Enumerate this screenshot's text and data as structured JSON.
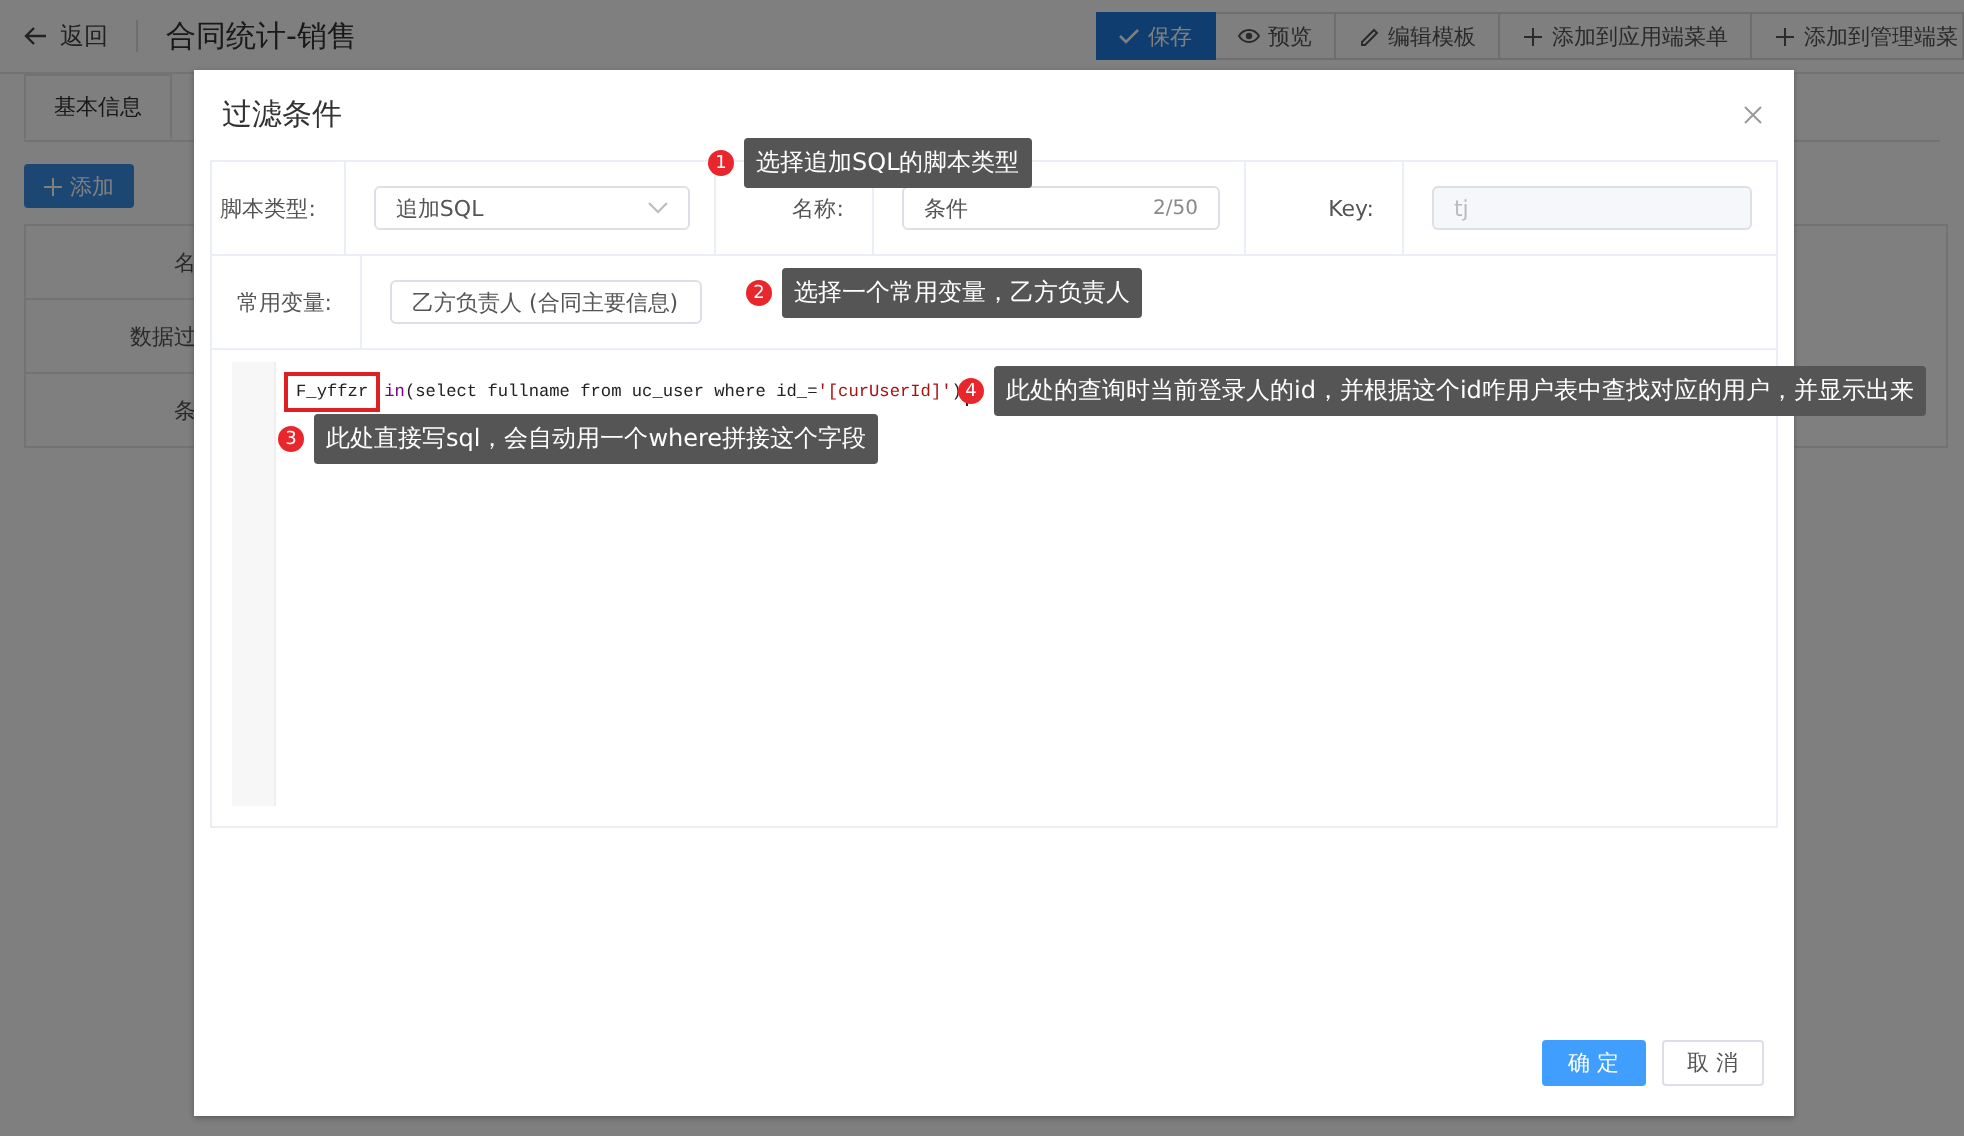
{
  "page": {
    "back": "返回",
    "title": "合同统计-销售",
    "toolbar": [
      {
        "label": "保存",
        "kind": "save"
      },
      {
        "label": "预览",
        "kind": "preview"
      },
      {
        "label": "编辑模板",
        "kind": "edit"
      },
      {
        "label": "添加到应用端菜单",
        "kind": "add"
      },
      {
        "label": "添加到管理端菜",
        "kind": "add"
      }
    ],
    "tabs": [
      {
        "label": "基本信息",
        "selected": true
      }
    ],
    "add_button": "添加",
    "table_labels": [
      "名",
      "数据过",
      "条"
    ]
  },
  "dialog": {
    "title": "过滤条件",
    "fields": [
      {
        "label": "脚本类型:",
        "kind": "select",
        "value": "追加SQL"
      },
      {
        "label": "名称:",
        "kind": "input",
        "value": "条件",
        "counter": "2/50"
      },
      {
        "label": "Key:",
        "kind": "disabled",
        "placeholder": "tj"
      },
      {
        "label": "常用变量:",
        "kind": "select",
        "value": "乙方负责人 (合同主要信息)"
      }
    ],
    "code": [
      {
        "text": "F_yffzr",
        "kind": "plain",
        "boxed": true
      },
      {
        "text": "in",
        "kind": "keyword"
      },
      {
        "text": "(select fullname from uc_user where id_=",
        "kind": "plain"
      },
      {
        "text": "'[curUserId]'",
        "kind": "string"
      },
      {
        "text": ")",
        "kind": "plain"
      }
    ],
    "buttons": [
      {
        "label": "确 定",
        "kind": "primary"
      },
      {
        "label": "取 消",
        "kind": "plain"
      }
    ]
  },
  "callouts": [
    {
      "number": "1",
      "text": "选择追加SQL的脚本类型"
    },
    {
      "number": "2",
      "text": "选择一个常用变量，乙方负责人"
    },
    {
      "number": "3",
      "text": "此处直接写sql，会自动用一个where拼接这个字段"
    },
    {
      "number": "4",
      "text": "此处的查询时当前登录人的id，并根据这个id咋用户表中查找对应的用户，并显示出来"
    }
  ]
}
